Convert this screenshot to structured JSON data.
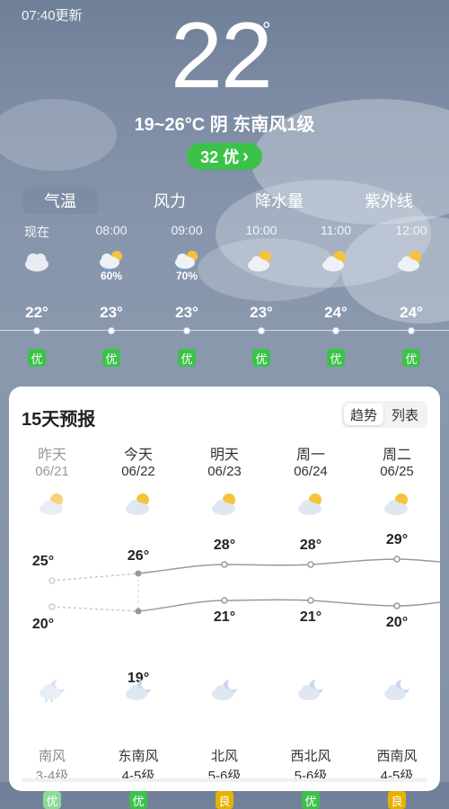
{
  "header": {
    "update_time": "07:40更新",
    "current_temp": "22",
    "degree_symbol": "°",
    "summary": "19~26°C 阴 东南风1级",
    "aqi_label": "32 优",
    "aqi_chevron": "›"
  },
  "tabs": [
    {
      "label": "气温",
      "active": true
    },
    {
      "label": "风力",
      "active": false
    },
    {
      "label": "降水量",
      "active": false
    },
    {
      "label": "紫外线",
      "active": false
    }
  ],
  "hourly": [
    {
      "time": "现在",
      "icon": "cloudy-icon",
      "pop": "",
      "temp": "22°",
      "aqi": "优"
    },
    {
      "time": "08:00",
      "icon": "partly-sunny-rain-icon",
      "pop": "60%",
      "temp": "23°",
      "aqi": "优"
    },
    {
      "time": "09:00",
      "icon": "partly-sunny-rain-icon",
      "pop": "70%",
      "temp": "23°",
      "aqi": "优"
    },
    {
      "time": "10:00",
      "icon": "partly-sunny-icon",
      "pop": "",
      "temp": "23°",
      "aqi": "优"
    },
    {
      "time": "11:00",
      "icon": "partly-sunny-icon",
      "pop": "",
      "temp": "24°",
      "aqi": "优"
    },
    {
      "time": "12:00",
      "icon": "partly-sunny-icon",
      "pop": "",
      "temp": "24°",
      "aqi": "优"
    }
  ],
  "forecast": {
    "title": "15天预报",
    "view_trend": "趋势",
    "view_list": "列表",
    "days": [
      {
        "name": "昨天",
        "date": "06/21",
        "day_icon": "partly-sunny-icon",
        "high": "25°",
        "low": "20°",
        "night_icon": "cloudy-night-rain-icon",
        "wind": "南风",
        "level": "3-4级",
        "aqi": "优",
        "aqi_color": "#3cc24a",
        "past": true
      },
      {
        "name": "今天",
        "date": "06/22",
        "day_icon": "partly-sunny-icon",
        "high": "26°",
        "low": "19°",
        "night_icon": "cloudy-night-icon",
        "wind": "东南风",
        "level": "4-5级",
        "aqi": "优",
        "aqi_color": "#3cc24a",
        "past": false
      },
      {
        "name": "明天",
        "date": "06/23",
        "day_icon": "partly-sunny-icon",
        "high": "28°",
        "low": "21°",
        "night_icon": "cloudy-night-icon",
        "wind": "北风",
        "level": "5-6级",
        "aqi": "良",
        "aqi_color": "#e8b100",
        "past": false
      },
      {
        "name": "周一",
        "date": "06/24",
        "day_icon": "partly-sunny-icon",
        "high": "28°",
        "low": "21°",
        "night_icon": "cloudy-night-icon",
        "wind": "西北风",
        "level": "5-6级",
        "aqi": "优",
        "aqi_color": "#3cc24a",
        "past": false
      },
      {
        "name": "周二",
        "date": "06/25",
        "day_icon": "partly-sunny-icon",
        "high": "29°",
        "low": "20°",
        "night_icon": "cloudy-night-icon",
        "wind": "西南风",
        "level": "4-5级",
        "aqi": "良",
        "aqi_color": "#e8b100",
        "past": false
      }
    ]
  }
}
